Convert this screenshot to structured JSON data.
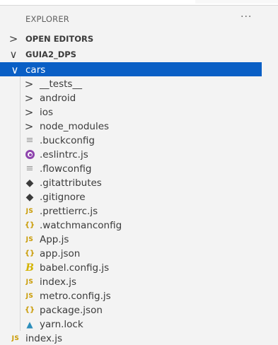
{
  "explorer": {
    "title": "EXPLORER",
    "more_actions": "···"
  },
  "sections": {
    "open_editors": {
      "label": "OPEN EDITORS",
      "chevron": ">"
    },
    "project": {
      "label": "GUIA2_DPS",
      "chevron": "∨"
    }
  },
  "tree": {
    "folder": {
      "label": "cars",
      "chevron": "∨"
    },
    "items": [
      {
        "label": "__tests__",
        "kind": "folder",
        "chevron": ">"
      },
      {
        "label": "android",
        "kind": "folder",
        "chevron": ">"
      },
      {
        "label": "ios",
        "kind": "folder",
        "chevron": ">"
      },
      {
        "label": "node_modules",
        "kind": "folder",
        "chevron": ">"
      },
      {
        "label": ".buckconfig",
        "kind": "config",
        "icon": "≡"
      },
      {
        "label": ".eslintrc.js",
        "kind": "eslint",
        "icon": "eslint-icon"
      },
      {
        "label": ".flowconfig",
        "kind": "config",
        "icon": "≡"
      },
      {
        "label": ".gitattributes",
        "kind": "git",
        "icon": "◆"
      },
      {
        "label": ".gitignore",
        "kind": "git",
        "icon": "◆"
      },
      {
        "label": ".prettierrc.js",
        "kind": "js",
        "icon": "JS"
      },
      {
        "label": ".watchmanconfig",
        "kind": "json",
        "icon": "{}"
      },
      {
        "label": "App.js",
        "kind": "js",
        "icon": "JS"
      },
      {
        "label": "app.json",
        "kind": "json",
        "icon": "{}"
      },
      {
        "label": "babel.config.js",
        "kind": "babel",
        "icon": "B"
      },
      {
        "label": "index.js",
        "kind": "js",
        "icon": "JS"
      },
      {
        "label": "metro.config.js",
        "kind": "js",
        "icon": "JS"
      },
      {
        "label": "package.json",
        "kind": "json",
        "icon": "{}"
      },
      {
        "label": "yarn.lock",
        "kind": "yarn",
        "icon": "yarn-icon"
      }
    ],
    "root_file": {
      "label": "index.js",
      "icon": "JS"
    }
  },
  "colors": {
    "selection": "#0a5fc5",
    "js": "#c99a00",
    "eslint": "#8e44ad",
    "yarn": "#2c8ebb"
  }
}
